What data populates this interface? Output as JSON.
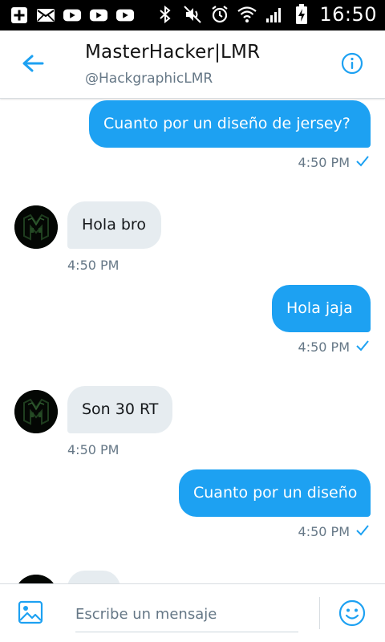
{
  "status_bar": {
    "time": "16:50",
    "left_icons": [
      "add-box-icon",
      "mail-icon",
      "youtube-icon",
      "youtube-icon",
      "youtube-icon"
    ],
    "right_icons": [
      "bluetooth-icon",
      "mute-icon",
      "alarm-icon",
      "wifi-icon",
      "signal-icon",
      "battery-charging-icon"
    ]
  },
  "header": {
    "display_name": "MasterHacker|LMR",
    "handle": "@HackgraphicLMR",
    "back_icon": "back-arrow-icon",
    "info_icon": "info-icon"
  },
  "conversation": {
    "messages": [
      {
        "direction": "out",
        "text": "Cuanto por un diseño de jersey?",
        "time": "4:50 PM",
        "read": true
      },
      {
        "direction": "in",
        "text": "Hola bro",
        "time": "4:50 PM"
      },
      {
        "direction": "out",
        "text": "Hola jaja",
        "time": "4:50 PM",
        "read": true
      },
      {
        "direction": "in",
        "text": "Son 30 RT",
        "time": "4:50 PM"
      },
      {
        "direction": "out",
        "text": "Cuanto por un diseño",
        "time": "4:50 PM",
        "read": true
      }
    ]
  },
  "composer": {
    "placeholder": "Escribe un mensaje",
    "media_icon": "image-icon",
    "emoji_icon": "emoji-icon"
  },
  "colors": {
    "accent": "#1da1f2",
    "incoming_bubble": "#e6ecf0",
    "secondary_text": "#657786"
  }
}
